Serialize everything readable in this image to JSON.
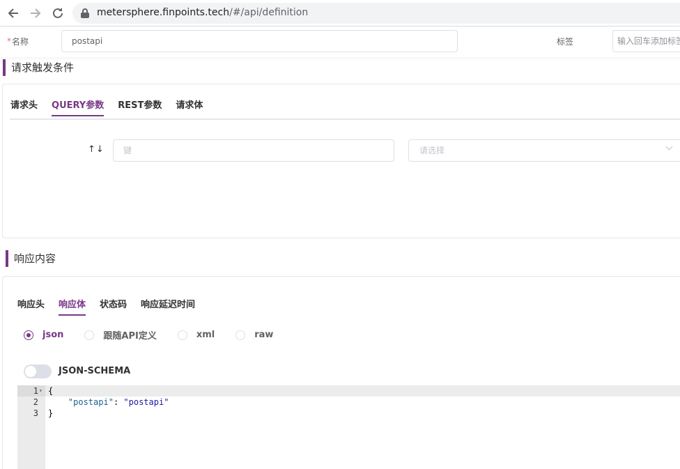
{
  "browser": {
    "url_host": "metersphere.finpoints.tech",
    "url_path": "/#/api/definition"
  },
  "form": {
    "required_mark": "*",
    "name_label": "名称",
    "name_value": "postapi",
    "tag_label": "标签",
    "tag_placeholder": "输入回车添加标签"
  },
  "request": {
    "title": "请求触发条件",
    "tabs": [
      {
        "label": "请求头",
        "active": false
      },
      {
        "label": "QUERY参数",
        "active": true
      },
      {
        "label": "REST参数",
        "active": false
      },
      {
        "label": "请求体",
        "active": false
      }
    ],
    "sort_arrows": "↑↓",
    "key_placeholder": "键",
    "select_placeholder": "请选择"
  },
  "response": {
    "title": "响应内容",
    "tabs": [
      {
        "label": "响应头",
        "active": false
      },
      {
        "label": "响应体",
        "active": true
      },
      {
        "label": "状态码",
        "active": false
      },
      {
        "label": "响应延迟时间",
        "active": false
      }
    ],
    "radios": [
      {
        "label": "json",
        "checked": true
      },
      {
        "label": "跟随API定义",
        "checked": false
      },
      {
        "label": "xml",
        "checked": false
      },
      {
        "label": "raw",
        "checked": false
      }
    ],
    "switch_label": "JSON-SCHEMA",
    "switch_on": false,
    "code": {
      "line_numbers": [
        "1",
        "2",
        "3"
      ],
      "open_brace": "{",
      "key": "\"postapi\"",
      "colon": ": ",
      "value": "\"postapi\"",
      "close_brace": "}"
    }
  },
  "colors": {
    "accent": "#783887",
    "border": "#dcdfe6",
    "required": "#f56c6c"
  },
  "icons": {
    "back": "arrow-left-icon",
    "forward": "arrow-right-icon",
    "reload": "reload-icon",
    "lock": "lock-icon",
    "select_chevron": "chevron-down-icon",
    "fold": "fold-arrow-icon"
  }
}
